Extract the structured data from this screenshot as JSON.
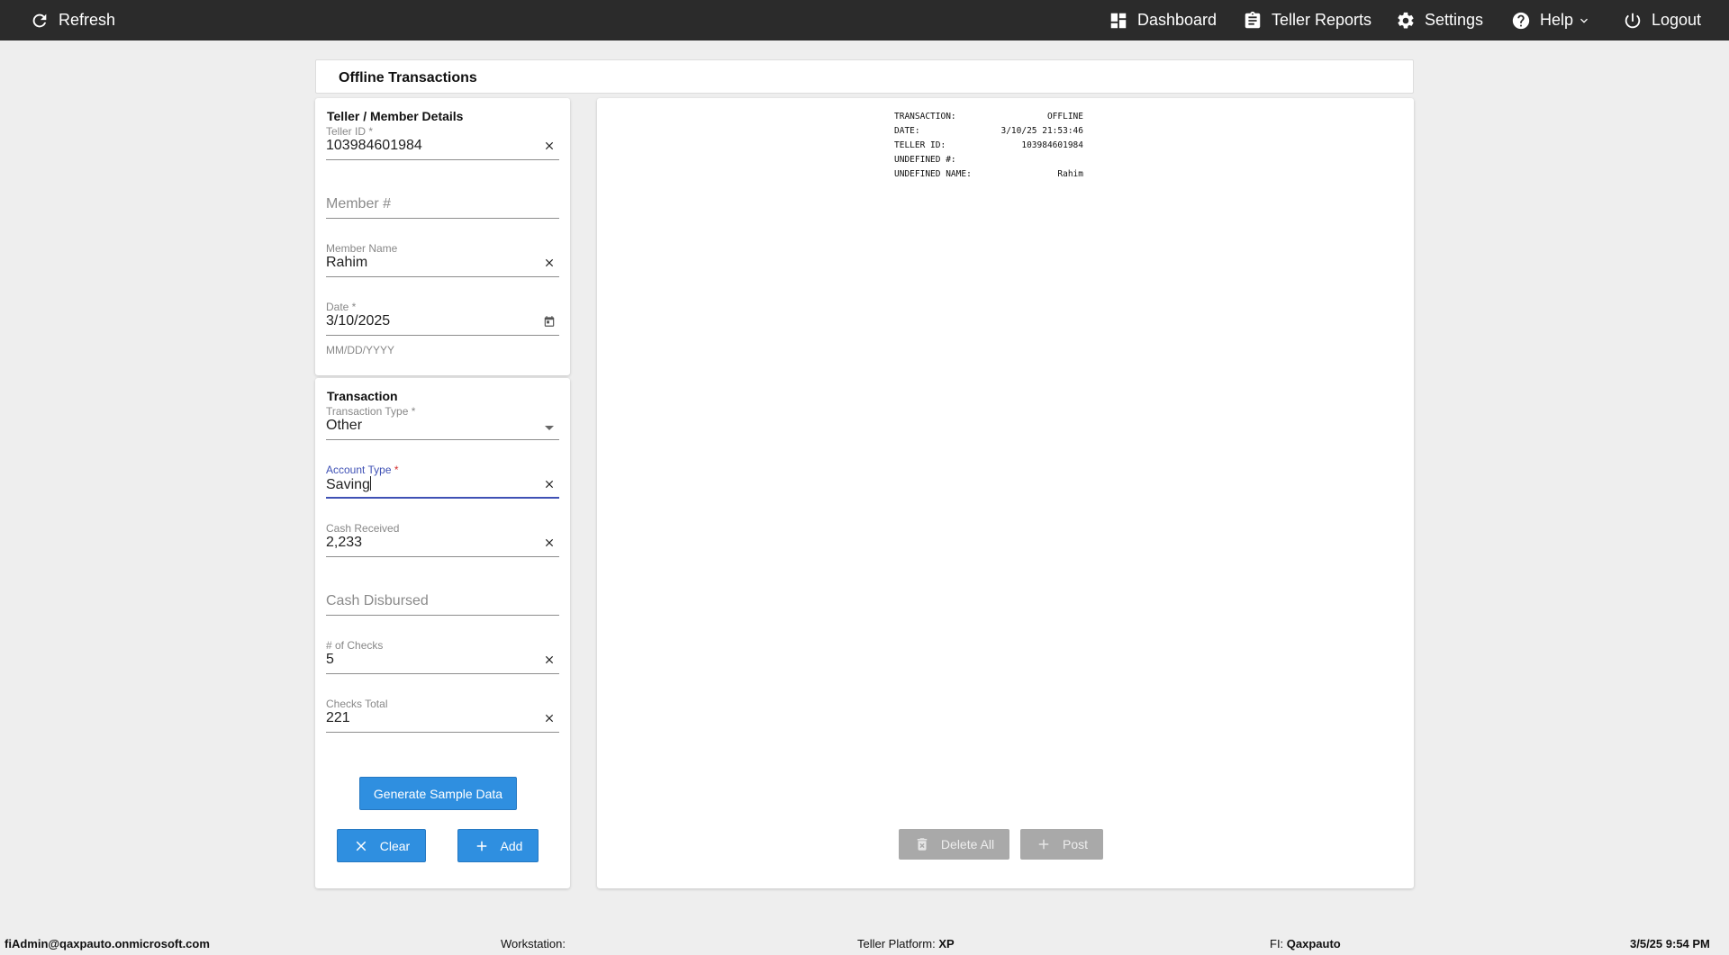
{
  "topbar": {
    "refresh": "Refresh",
    "dashboard": "Dashboard",
    "teller_reports": "Teller Reports",
    "settings": "Settings",
    "help": "Help",
    "logout": "Logout"
  },
  "header": {
    "title": "Offline Transactions"
  },
  "member_section": {
    "title": "Teller / Member Details",
    "teller_id": {
      "label": "Teller ID *",
      "value": "103984601984"
    },
    "member_num": {
      "placeholder": "Member #"
    },
    "member_name": {
      "label": "Member Name",
      "value": "Rahim"
    },
    "date": {
      "label": "Date *",
      "value": "3/10/2025",
      "helper": "MM/DD/YYYY"
    }
  },
  "transaction_section": {
    "title": "Transaction",
    "transaction_type": {
      "label": "Transaction Type *",
      "value": "Other"
    },
    "account_type": {
      "label": "Account Type",
      "required_mark": " *",
      "value": "Saving"
    },
    "cash_received": {
      "label": "Cash Received",
      "value": "2,233"
    },
    "cash_disbursed": {
      "placeholder": "Cash Disbursed"
    },
    "num_checks": {
      "label": "# of Checks",
      "value": "5"
    },
    "checks_total": {
      "label": "Checks Total",
      "value": "221"
    }
  },
  "buttons": {
    "generate": "Generate Sample Data",
    "clear": "Clear",
    "add": "Add",
    "delete_all": "Delete All",
    "post": "Post"
  },
  "receipt": {
    "rows": [
      {
        "label": "TRANSACTION:",
        "value": "OFFLINE"
      },
      {
        "label": "DATE:",
        "value": "3/10/25 21:53:46"
      },
      {
        "label": "TELLER ID:",
        "value": "103984601984"
      },
      {
        "label": "UNDEFINED #:",
        "value": ""
      },
      {
        "label": "UNDEFINED NAME:",
        "value": "Rahim"
      }
    ]
  },
  "statusbar": {
    "user": "fiAdmin@qaxpauto.onmicrosoft.com",
    "workstation_label": "Workstation:",
    "workstation_value": "",
    "platform_label": "Teller Platform:",
    "platform_value": "XP",
    "fi_label": "FI:",
    "fi_value": "Qaxpauto",
    "datetime": "3/5/25 9:54 PM"
  },
  "colors": {
    "topbar": "#2b2b2b",
    "primary_button": "#2f8fe0",
    "focus": "#3f51b5",
    "disabled_button": "#a9a9a9"
  }
}
